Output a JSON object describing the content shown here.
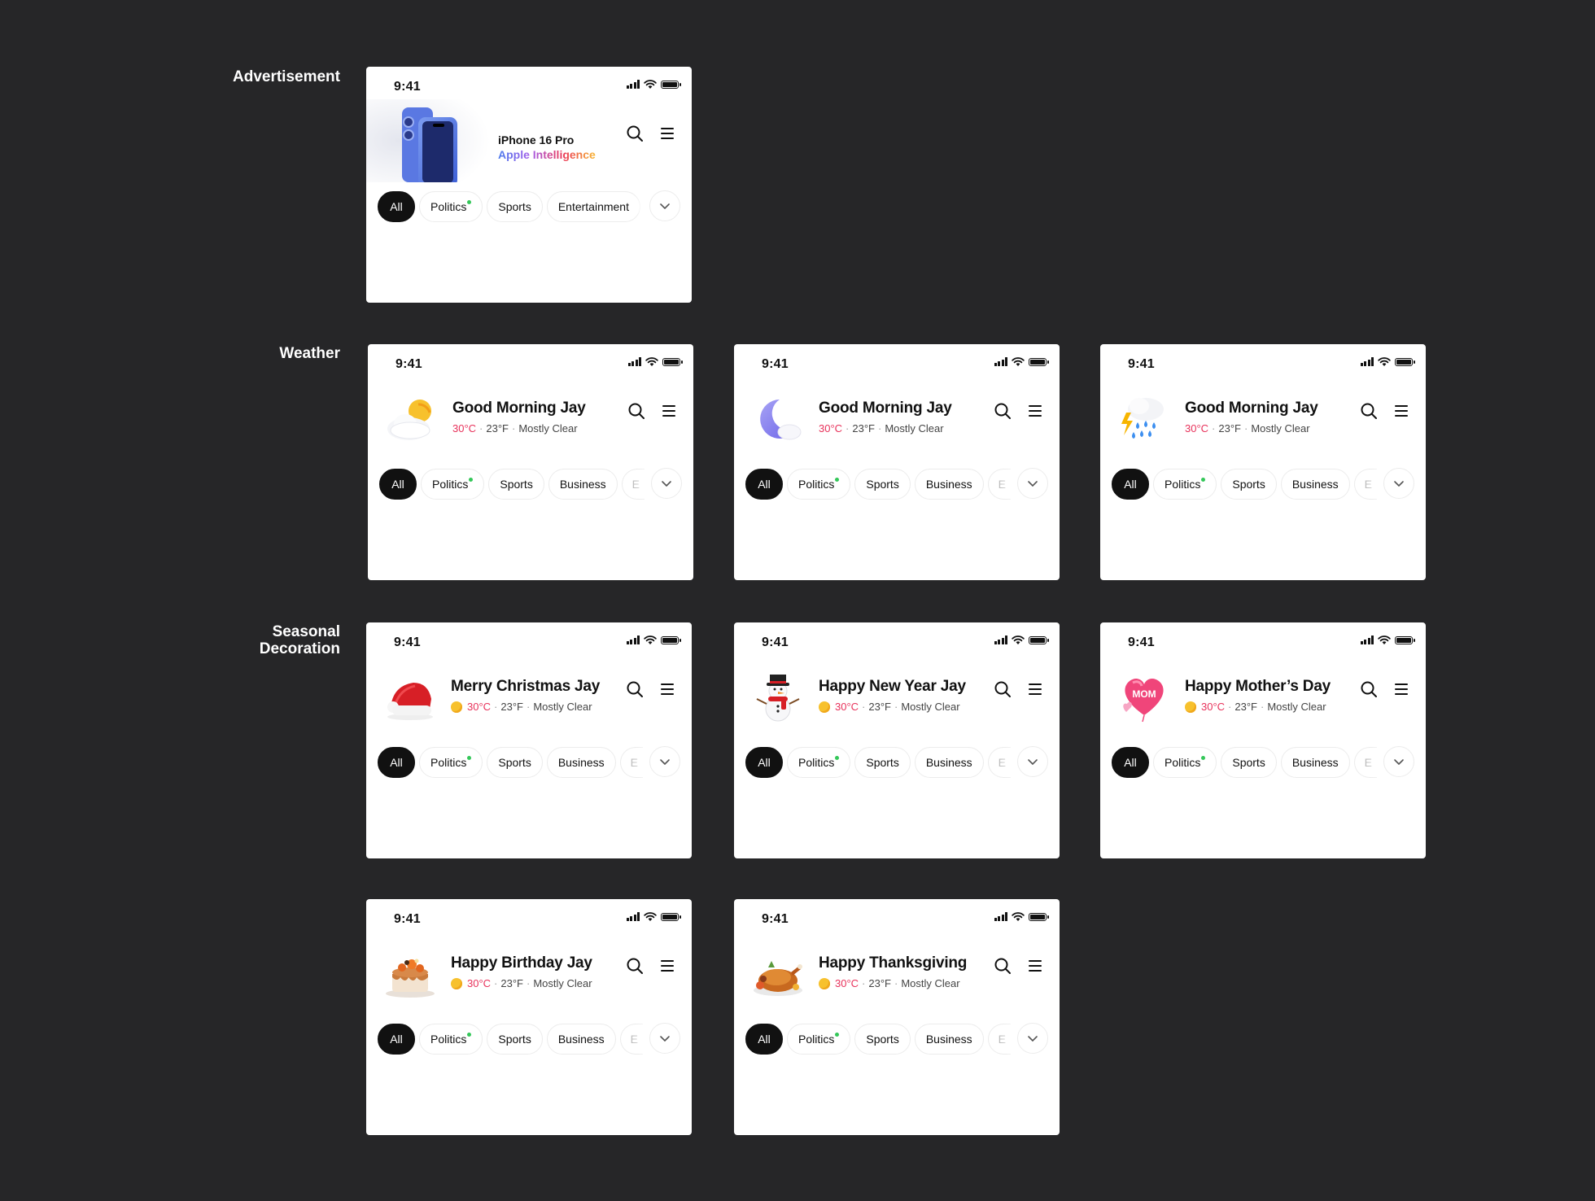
{
  "sections": {
    "advertisement": "Advertisement",
    "weather": "Weather",
    "seasonal": "Seasonal\nDecoration"
  },
  "status": {
    "time": "9:41"
  },
  "chips": {
    "all": "All",
    "politics": "Politics",
    "sports": "Sports",
    "entertainment": "Entertainment",
    "business": "Business",
    "partial": "E"
  },
  "ad": {
    "title": "iPhone 16 Pro",
    "subtitle": "Apple Intelligence"
  },
  "weather_info": {
    "celsius": "30°C",
    "fahrenheit": "23°F",
    "condition": "Mostly Clear"
  },
  "cards": [
    {
      "id": "weather-sunny",
      "greeting": "Good Morning Jay",
      "icon": "partly-cloudy-icon"
    },
    {
      "id": "weather-night",
      "greeting": "Good Morning Jay",
      "icon": "moon-cloud-icon"
    },
    {
      "id": "weather-storm",
      "greeting": "Good Morning Jay",
      "icon": "storm-rain-icon"
    },
    {
      "id": "christmas",
      "greeting": "Merry Christmas Jay",
      "icon": "santa-hat-icon"
    },
    {
      "id": "new-year",
      "greeting": "Happy New Year Jay",
      "icon": "snowman-icon"
    },
    {
      "id": "mothers-day",
      "greeting": "Happy Mother’s Day",
      "icon": "mom-heart-balloon-icon",
      "balloon_text": "MOM"
    },
    {
      "id": "birthday",
      "greeting": "Happy Birthday Jay",
      "icon": "birthday-cake-icon"
    },
    {
      "id": "thanksgiving",
      "greeting": "Happy Thanksgiving",
      "icon": "roast-turkey-icon"
    }
  ]
}
